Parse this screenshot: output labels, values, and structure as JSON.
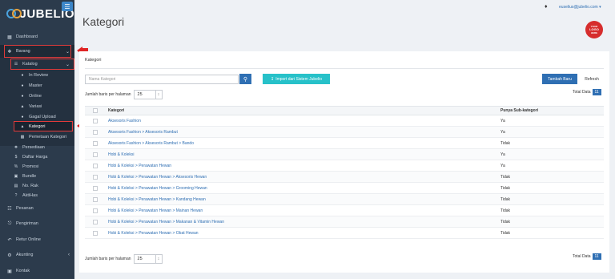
{
  "app": {
    "logo_text": "JUBELIO",
    "menu_icon": "hamburger-icon"
  },
  "sidebar": {
    "items": [
      {
        "label": "Dashboard",
        "icon": "dashboard-icon"
      },
      {
        "label": "Barang",
        "icon": "cubes-icon"
      },
      {
        "label": "Katalog",
        "icon": "list-icon"
      },
      {
        "label": "In Review",
        "icon": "circle-icon"
      },
      {
        "label": "Master",
        "icon": "circle-icon"
      },
      {
        "label": "Online",
        "icon": "circle-icon"
      },
      {
        "label": "Variasi",
        "icon": "tag-icon"
      },
      {
        "label": "Gagal Upload",
        "icon": "circle-icon"
      },
      {
        "label": "Kategori",
        "icon": "flag-icon"
      },
      {
        "label": "Pemetaan Kategori",
        "icon": "map-icon"
      },
      {
        "label": "Persediaan",
        "icon": "cubes-icon"
      },
      {
        "label": "Daftar Harga",
        "icon": "dollar-icon"
      },
      {
        "label": "Promosi",
        "icon": "percent-icon"
      },
      {
        "label": "Bundle",
        "icon": "box-icon"
      },
      {
        "label": "No. Rak",
        "icon": "shelf-icon"
      },
      {
        "label": "AktiHas",
        "icon": "question-icon"
      },
      {
        "label": "Pesanan",
        "icon": "cart-icon"
      },
      {
        "label": "Pengiriman",
        "icon": "truck-icon"
      },
      {
        "label": "Retur Online",
        "icon": "return-icon"
      },
      {
        "label": "Akunting",
        "icon": "gear-icon"
      },
      {
        "label": "Kontak",
        "icon": "contact-icon"
      }
    ]
  },
  "header": {
    "title": "Kategori",
    "user_email": " euselius@jubelio.com ▾",
    "badge_lines": [
      "YOUR",
      "LOGO",
      "HERE"
    ]
  },
  "card": {
    "tab": "Kategori",
    "search_placeholder": "Nama Kategori",
    "import_label": "Import dari Sistem Jubelio",
    "add_label": "Tambah Baru",
    "refresh_label": "Refresh",
    "per_page_label": "Jumlah baris per halaman",
    "per_page_value": "25",
    "total_label": "Total Data",
    "total_value": "11"
  },
  "table": {
    "headers": [
      "Kategori",
      "Punya Sub-kategori"
    ],
    "rows": [
      [
        "Aksesoris Fashion",
        "Ya"
      ],
      [
        "Aksesoris Fashion > Aksesoris Rambut",
        "Ya"
      ],
      [
        "Aksesoris Fashion > Aksesoris Rambut > Bando",
        "Tidak"
      ],
      [
        "Hobi & Koleksi",
        "Ya"
      ],
      [
        "Hobi & Koleksi > Perawatan Hewan",
        "Ya"
      ],
      [
        "Hobi & Koleksi > Perawatan Hewan > Aksesoris Hewan",
        "Tidak"
      ],
      [
        "Hobi & Koleksi > Perawatan Hewan > Grooming Hewan",
        "Tidak"
      ],
      [
        "Hobi & Koleksi > Perawatan Hewan > Kandang Hewan",
        "Tidak"
      ],
      [
        "Hobi & Koleksi > Perawatan Hewan > Mainan Hewan",
        "Tidak"
      ],
      [
        "Hobi & Koleksi > Perawatan Hewan > Makanan & Vitamin Hewan",
        "Tidak"
      ],
      [
        "Hobi & Koleksi > Perawatan Hewan > Obat Hewan",
        "Tidak"
      ]
    ]
  },
  "colors": {
    "sidebar": "#2c3b4c",
    "primary": "#2f6fb3",
    "accent": "#27c1c9",
    "annotation": "#e02424"
  }
}
